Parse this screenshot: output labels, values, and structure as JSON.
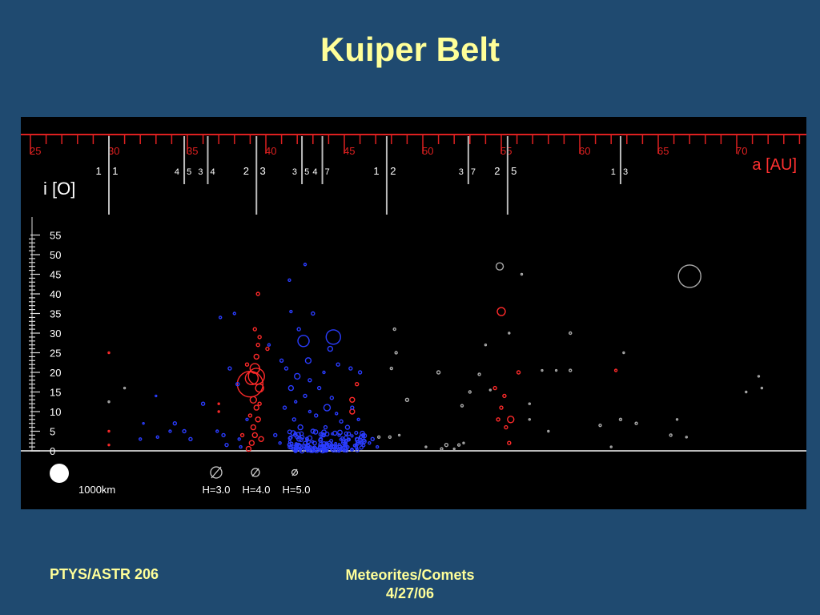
{
  "slide": {
    "title": "Kuiper Belt",
    "footer_left": "PTYS/ASTR 206",
    "footer_center_line1": "Meteorites/Comets",
    "footer_center_line2": "4/27/06"
  },
  "colors": {
    "background": "#1f4a70",
    "title": "#ffff99",
    "plot_background": "#000000",
    "axis_red": "#dd2020",
    "resonant": "#ff2a2a",
    "classical": "#2a3cff",
    "scattered": "#aaaaaa"
  },
  "chart_data": {
    "type": "scatter",
    "xlabel": "a [AU]",
    "ylabel": "i [O]",
    "xlim": [
      25,
      75
    ],
    "ylim": [
      0,
      55
    ],
    "x_ticks": [
      25,
      30,
      35,
      40,
      45,
      50,
      55,
      60,
      65,
      70
    ],
    "y_ticks": [
      0,
      5,
      10,
      15,
      20,
      25,
      30,
      35,
      40,
      45,
      50,
      55
    ],
    "resonances": [
      {
        "a": 30.0,
        "label": "1 1",
        "major": true
      },
      {
        "a": 34.8,
        "label": "4 5",
        "major": false
      },
      {
        "a": 36.3,
        "label": "3 4",
        "major": false
      },
      {
        "a": 39.4,
        "label": "2 3",
        "major": true
      },
      {
        "a": 42.3,
        "label": "3 5",
        "major": false
      },
      {
        "a": 43.6,
        "label": "4 7",
        "major": false
      },
      {
        "a": 47.7,
        "label": "1 2",
        "major": true
      },
      {
        "a": 52.9,
        "label": "3 7",
        "major": false
      },
      {
        "a": 55.4,
        "label": "2 5",
        "major": true
      },
      {
        "a": 62.6,
        "label": "1 3",
        "major": false
      }
    ],
    "size_legend": {
      "scale_label": "1000km",
      "entries": [
        "H=3.0",
        "H=4.0",
        "H=5.0"
      ]
    },
    "series": [
      {
        "group": "resonant",
        "color": "#ff2a2a",
        "points": [
          [
            39.0,
            17.0,
            16
          ],
          [
            39.1,
            18.5,
            8
          ],
          [
            39.3,
            21,
            6
          ],
          [
            39.4,
            19,
            10
          ],
          [
            39.6,
            16,
            5
          ],
          [
            39.2,
            13,
            4
          ],
          [
            39.4,
            11,
            3
          ],
          [
            39.5,
            8,
            3
          ],
          [
            39.2,
            6,
            3
          ],
          [
            39.3,
            4,
            3
          ],
          [
            39.1,
            2,
            3
          ],
          [
            38.9,
            0.5,
            3
          ],
          [
            39.4,
            24,
            3
          ],
          [
            39.5,
            27,
            2
          ],
          [
            39.3,
            31,
            2
          ],
          [
            39.6,
            29,
            2
          ],
          [
            39.5,
            40,
            2
          ],
          [
            40.1,
            26,
            2
          ],
          [
            38.5,
            4,
            2
          ],
          [
            39.7,
            3,
            3
          ],
          [
            39.0,
            9,
            2
          ],
          [
            39.6,
            12,
            2
          ],
          [
            38.8,
            22,
            2
          ],
          [
            55.0,
            35.5,
            5
          ],
          [
            54.6,
            16,
            2
          ],
          [
            55.2,
            14,
            2
          ],
          [
            55.0,
            11,
            2
          ],
          [
            55.6,
            8,
            4
          ],
          [
            55.3,
            6,
            2
          ],
          [
            55.5,
            2,
            2
          ],
          [
            56.1,
            20,
            2
          ],
          [
            54.8,
            8,
            2
          ],
          [
            45.5,
            13,
            3
          ],
          [
            45.5,
            10,
            3
          ],
          [
            45.8,
            17,
            2
          ],
          [
            30.0,
            25,
            1
          ],
          [
            30.0,
            5,
            1
          ],
          [
            30.0,
            1.5,
            1
          ],
          [
            37.0,
            12,
            1
          ],
          [
            37.0,
            10,
            1
          ],
          [
            62.3,
            20.5,
            1.5
          ]
        ]
      },
      {
        "group": "classical",
        "color": "#2a3cff",
        "points": [
          [
            44.3,
            29,
            9
          ],
          [
            42.4,
            28,
            7
          ],
          [
            42.7,
            23,
            3.5
          ],
          [
            42.0,
            19,
            3.5
          ],
          [
            43.9,
            11,
            4
          ],
          [
            44.1,
            26,
            3
          ],
          [
            41.6,
            16,
            3
          ],
          [
            41.0,
            23,
            2
          ],
          [
            42.5,
            14,
            2
          ],
          [
            43.2,
            9,
            2
          ],
          [
            41.8,
            8,
            2
          ],
          [
            42.2,
            6,
            3
          ],
          [
            43.0,
            5,
            2.5
          ],
          [
            44.4,
            4.5,
            2.5
          ],
          [
            45.2,
            6,
            2.5
          ],
          [
            43.5,
            3,
            2
          ],
          [
            42.0,
            3.5,
            2
          ],
          [
            44.0,
            1.5,
            2
          ],
          [
            46.2,
            4,
            2
          ],
          [
            45.8,
            3,
            2
          ],
          [
            41.5,
            1.5,
            2
          ],
          [
            46.8,
            3,
            2
          ],
          [
            43.1,
            0.8,
            2
          ],
          [
            44.7,
            1,
            2
          ],
          [
            42.5,
            2,
            2
          ],
          [
            43.8,
            6,
            2
          ],
          [
            44.8,
            7.5,
            2
          ],
          [
            45.5,
            11,
            2
          ],
          [
            46.0,
            20,
            2
          ],
          [
            41.3,
            21,
            2
          ],
          [
            42.1,
            31,
            2
          ],
          [
            43.0,
            35,
            2
          ],
          [
            41.6,
            35.5,
            1.5
          ],
          [
            41.5,
            43.5,
            1.5
          ],
          [
            42.5,
            47.5,
            1.5
          ],
          [
            44.6,
            22,
            2
          ],
          [
            45.4,
            21,
            2
          ],
          [
            44.2,
            13.5,
            2
          ],
          [
            43.4,
            16,
            2
          ],
          [
            42.8,
            18,
            2
          ],
          [
            41.2,
            11,
            2
          ],
          [
            40.6,
            4,
            2
          ],
          [
            40.9,
            2,
            1.5
          ],
          [
            38.3,
            3,
            1.5
          ],
          [
            38.8,
            8,
            1.5
          ],
          [
            37.3,
            4,
            2
          ],
          [
            36.9,
            5,
            1.5
          ],
          [
            36.0,
            12,
            2
          ],
          [
            37.7,
            21,
            2
          ],
          [
            38.0,
            35,
            1.5
          ],
          [
            37.1,
            34,
            1.5
          ],
          [
            40.2,
            27,
            1.5
          ],
          [
            38.2,
            17,
            2
          ],
          [
            34.8,
            5,
            2
          ],
          [
            33.9,
            5,
            1.5
          ],
          [
            33.1,
            3.5,
            1.5
          ],
          [
            32.0,
            3,
            1.5
          ],
          [
            35.2,
            3,
            2
          ],
          [
            34.2,
            7,
            2
          ],
          [
            37.5,
            1.5,
            2
          ],
          [
            38.4,
            1,
            1.5
          ],
          [
            33.0,
            14,
            1
          ],
          [
            32.2,
            7,
            1
          ],
          [
            46.6,
            2,
            1.5
          ],
          [
            47.1,
            1,
            1.5
          ],
          [
            42.8,
            10,
            1.5
          ],
          [
            41.9,
            12.5,
            1.5
          ],
          [
            45.9,
            8,
            1.5
          ],
          [
            44.5,
            9.5,
            1.5
          ],
          [
            43.7,
            20,
            1.5
          ]
        ],
        "cluster": {
          "a_min": 41.5,
          "a_max": 46.3,
          "i_max": 5,
          "count": 150
        }
      },
      {
        "group": "scattered",
        "color": "#aaaaaa",
        "points": [
          [
            67.0,
            44.5,
            14
          ],
          [
            54.9,
            47,
            4.5
          ],
          [
            48.2,
            31,
            1.5
          ],
          [
            48.3,
            25,
            1.5
          ],
          [
            48.0,
            21,
            1.5
          ],
          [
            49.0,
            13,
            2
          ],
          [
            51.0,
            20,
            2
          ],
          [
            51.5,
            1.5,
            2
          ],
          [
            52.3,
            1.5,
            1.5
          ],
          [
            52.5,
            11.5,
            1.5
          ],
          [
            53.6,
            19.5,
            1.5
          ],
          [
            53.0,
            15,
            1.5
          ],
          [
            54.3,
            15.5,
            1
          ],
          [
            55.5,
            30,
            1
          ],
          [
            54.0,
            27,
            1
          ],
          [
            59.4,
            30,
            1.5
          ],
          [
            59.4,
            20.5,
            1.5
          ],
          [
            58.5,
            20.5,
            1
          ],
          [
            57.6,
            20.5,
            1
          ],
          [
            56.8,
            12,
            1
          ],
          [
            56.8,
            8,
            1
          ],
          [
            58.0,
            5,
            1
          ],
          [
            61.3,
            6.5,
            1.5
          ],
          [
            62.6,
            8,
            1.5
          ],
          [
            63.6,
            7,
            1.5
          ],
          [
            66.2,
            8,
            1
          ],
          [
            65.8,
            4,
            1.5
          ],
          [
            66.8,
            3.5,
            1
          ],
          [
            70.6,
            15,
            1
          ],
          [
            71.4,
            19,
            1
          ],
          [
            71.6,
            16,
            1
          ],
          [
            62.0,
            1,
            1
          ],
          [
            47.9,
            3.5,
            1.5
          ],
          [
            47.2,
            3.5,
            1.5
          ],
          [
            48.5,
            4,
            1
          ],
          [
            50.2,
            1,
            1
          ],
          [
            51.2,
            0.5,
            1.5
          ],
          [
            52.0,
            0.5,
            1
          ],
          [
            52.6,
            2,
            1
          ],
          [
            62.8,
            25,
            1
          ],
          [
            56.3,
            45,
            1
          ],
          [
            31.0,
            16,
            1
          ],
          [
            30.0,
            12.5,
            1
          ]
        ]
      }
    ]
  }
}
